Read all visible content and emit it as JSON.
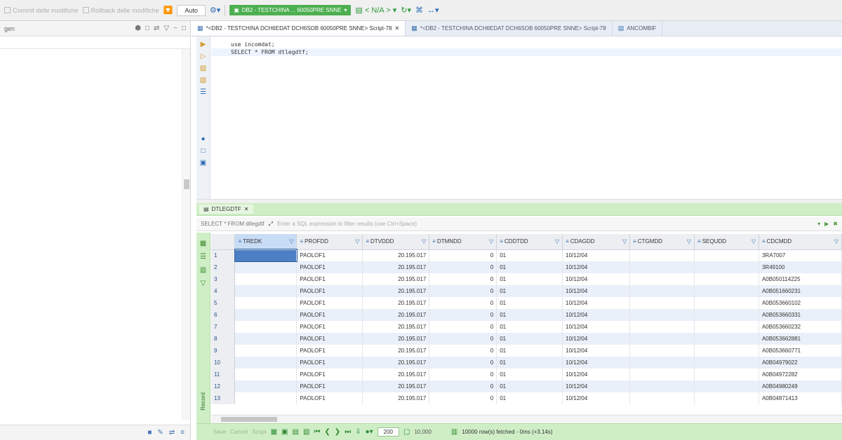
{
  "toolbar": {
    "commit_label": "Commit delle modifiche",
    "rollback_label": "Rollback delle modifiche",
    "auto_label": "Auto",
    "connection_label": "DB2 - TESTCHINA ... 60050PRE SNNE",
    "schema_label": "< N/A >"
  },
  "left_panel": {
    "title": "gen"
  },
  "tabs": [
    {
      "label": "*<DB2 - TESTCHINA DCH6EDAT DCH6SOB 60050PRE SNNE> Script-78"
    },
    {
      "label": "*<DB2 - TESTCHINA DCH6EDAT DCH6SOB 60050PRE SNNE> Script-78"
    },
    {
      "label": "ANCOMBIF"
    }
  ],
  "editor": {
    "lines": [
      "use incomdat;",
      "SELECT * FROM dtlegdtf;"
    ]
  },
  "results": {
    "tab_label": "DTLEGDTF",
    "query_text": "SELECT * FROM dtlegdtf",
    "filter_placeholder": "Enter a SQL expression to filter results (use Ctrl+Space)",
    "side_label": "Record",
    "columns": [
      "TREDK",
      "PROFDD",
      "DTVDDD",
      "DTMNDD",
      "CDDTDD",
      "CDAGDD",
      "CTGMDD",
      "SEQUDD",
      "CDCMDD"
    ],
    "rows": [
      [
        "1",
        "",
        "PAOLOF1",
        "20.195.017",
        "0",
        "01",
        "10/12/04",
        "",
        "",
        "3RA7007"
      ],
      [
        "2",
        "",
        "PAOLOF1",
        "20.195.017",
        "0",
        "01",
        "10/12/04",
        "",
        "",
        "3R49100"
      ],
      [
        "3",
        "",
        "PAOLOF1",
        "20.195.017",
        "0",
        "01",
        "10/12/04",
        "",
        "",
        "A0B050114225"
      ],
      [
        "4",
        "",
        "PAOLOF1",
        "20.195.017",
        "0",
        "01",
        "10/12/04",
        "",
        "",
        "A0B051660231"
      ],
      [
        "5",
        "",
        "PAOLOF1",
        "20.195.017",
        "0",
        "01",
        "10/12/04",
        "",
        "",
        "A0B053660102"
      ],
      [
        "6",
        "",
        "PAOLOF1",
        "20.195.017",
        "0",
        "01",
        "10/12/04",
        "",
        "",
        "A0B053660331"
      ],
      [
        "7",
        "",
        "PAOLOF1",
        "20.195.017",
        "0",
        "01",
        "10/12/04",
        "",
        "",
        "A0B053660232"
      ],
      [
        "8",
        "",
        "PAOLOF1",
        "20.195.017",
        "0",
        "01",
        "10/12/04",
        "",
        "",
        "A0B053662881"
      ],
      [
        "9",
        "",
        "PAOLOF1",
        "20.195.017",
        "0",
        "01",
        "10/12/04",
        "",
        "",
        "A0B053660771"
      ],
      [
        "10",
        "",
        "PAOLOF1",
        "20.195.017",
        "0",
        "01",
        "10/12/04",
        "",
        "",
        "A0B04979022"
      ],
      [
        "11",
        "",
        "PAOLOF1",
        "20.195.017",
        "0",
        "01",
        "10/12/04",
        "",
        "",
        "A0B04972282"
      ],
      [
        "12",
        "",
        "PAOLOF1",
        "20.195.017",
        "0",
        "01",
        "10/12/04",
        "",
        "",
        "A0B04980249"
      ],
      [
        "13",
        "",
        "PAOLOF1",
        "20.195.017",
        "0",
        "01",
        "10/12/04",
        "",
        "",
        "A0B04871413"
      ]
    ]
  },
  "status": {
    "save_label": "Save",
    "cancel_label": "Cancel",
    "script_label": "Script",
    "fetch_size": "200",
    "fetch_count": "10,000",
    "message": "10000 row(s) fetched - 0ms (+3.14s)"
  }
}
